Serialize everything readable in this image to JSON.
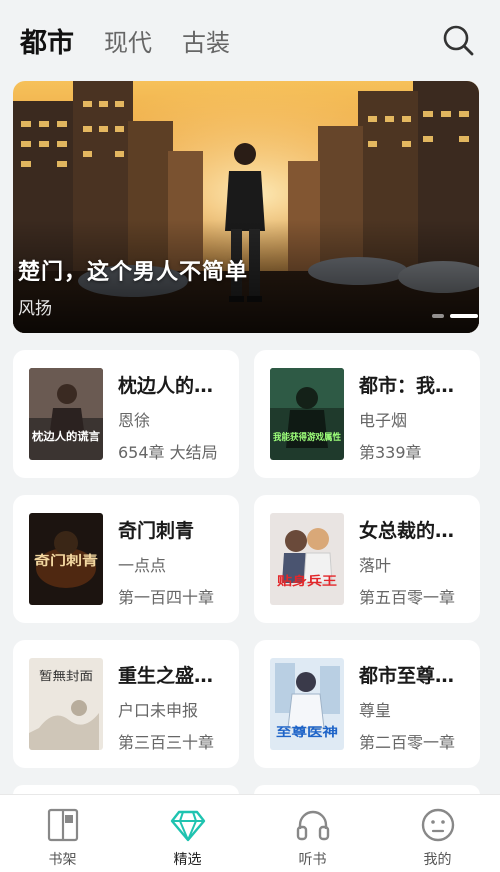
{
  "tabs": [
    {
      "label": "都市",
      "active": true
    },
    {
      "label": "现代",
      "active": false
    },
    {
      "label": "古装",
      "active": false
    }
  ],
  "banner": {
    "title": "楚门，这个男人不简单",
    "subtitle": "风扬",
    "slide_count": 2,
    "active_slide": 2
  },
  "books": [
    {
      "title": "枕边人的谎言",
      "author": "恩徐",
      "meta": "654章 大结局",
      "cover_text": "枕边人的谎言"
    },
    {
      "title": "都市：我能获得游戏属性",
      "author": "电子烟",
      "meta": "第339章",
      "cover_text": "我能获得游戏属性"
    },
    {
      "title": "奇门刺青",
      "author": "一点点",
      "meta": "第一百四十章",
      "cover_text": "奇门刺青"
    },
    {
      "title": "女总裁的贴身兵王",
      "author": "落叶",
      "meta": "第五百零一章",
      "cover_text": "贴身兵王"
    },
    {
      "title": "重生之盛世豪门",
      "author": "户口未申报",
      "meta": "第三百三十章",
      "cover_text": "暂無封面"
    },
    {
      "title": "都市至尊医神",
      "author": "尊皇",
      "meta": "第二百零一章",
      "cover_text": "至尊医神"
    }
  ],
  "bottom_nav": [
    {
      "label": "书架",
      "icon": "bookshelf-icon",
      "active": false
    },
    {
      "label": "精选",
      "icon": "diamond-icon",
      "active": true
    },
    {
      "label": "听书",
      "icon": "headphones-icon",
      "active": false
    },
    {
      "label": "我的",
      "icon": "profile-icon",
      "active": false
    }
  ],
  "colors": {
    "accent": "#1fc3b0",
    "background": "#f1f3f4",
    "card": "#ffffff"
  }
}
